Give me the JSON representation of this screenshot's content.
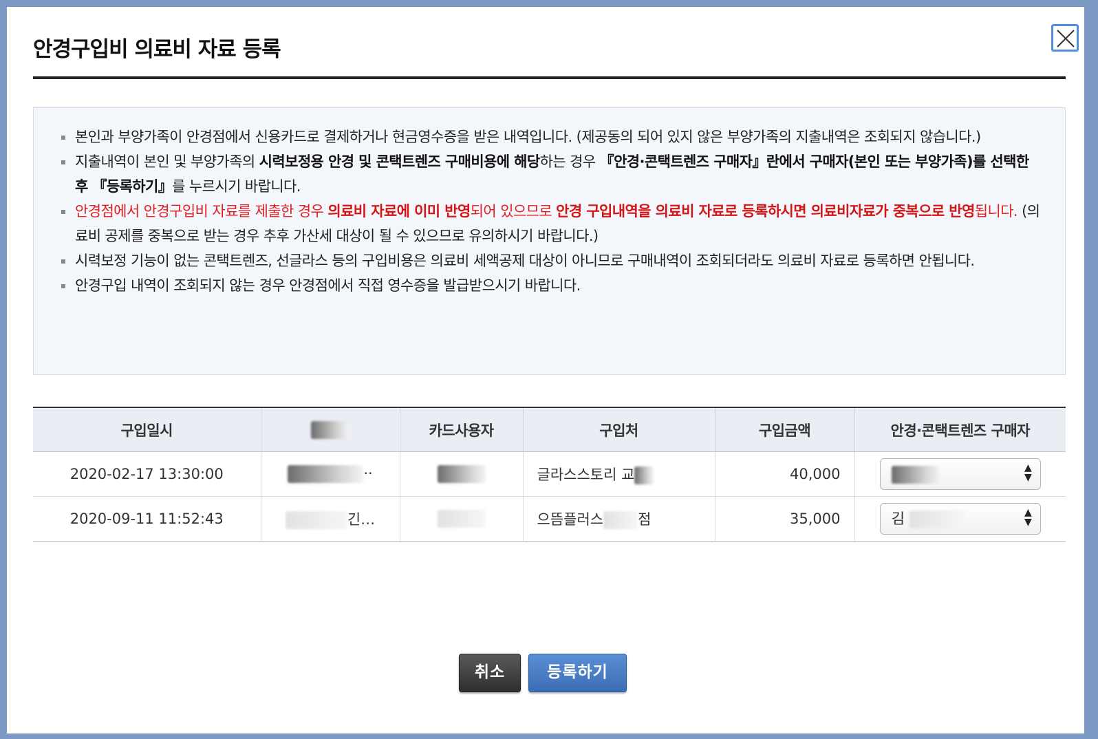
{
  "dialog": {
    "title": "안경구입비 의료비 자료 등록",
    "close_icon": "close-icon"
  },
  "notice": {
    "item1": "본인과 부양가족이 안경점에서 신용카드로 결제하거나 현금영수증을 받은 내역입니다. (제공동의 되어 있지 않은 부양가족의 지출내역은 조회되지 않습니다.)",
    "item2": {
      "t1": "지출내역이 본인 및 부양가족의 ",
      "b1": "시력보정용 안경 및 콘택트렌즈 구매비용에 해당",
      "t2": "하는 경우 ",
      "b2": "『안경·콘택트렌즈 구매자』란에서 구매자(본인 또는 부양가족)를 선택한 후 『등록하기』",
      "t3": "를 누르시기 바랍니다."
    },
    "item3": {
      "t1": "안경점에서 안경구입비 자료를 제출한 경우 ",
      "b1": "의료비 자료에 이미 반영",
      "t2": "되어 있으므로 ",
      "b2": "안경 구입내역을 의료비 자료로 등록하시면 의료비자료가 중복으로 반영",
      "t3": "됩니다.",
      "t4": " (의료비 공제를 중복으로 받는 경우 추후 가산세 대상이 될 수 있으므로 유의하시기 바랍니다.)"
    },
    "item4": "시력보정 기능이 없는 콘택트렌즈, 선글라스 등의 구입비용은 의료비 세액공제 대상이 아니므로 구매내역이 조회되더라도 의료비 자료로 등록하면 안됩니다.",
    "item5": "안경구입 내역이 조회되지 않는 경우 안경점에서 직접 영수증을 발급받으시기 바랍니다."
  },
  "table": {
    "headers": [
      "구입일시",
      "",
      "카드사용자",
      "구입처",
      "구입금액",
      "안경·콘택트렌즈 구매자"
    ],
    "rows": [
      {
        "date": "2020-02-17 13:30:00",
        "col2_suffix": "··",
        "card_user": "",
        "store": "글라스스토리 교",
        "amount": "40,000",
        "buyer": ""
      },
      {
        "date": "2020-09-11 11:52:43",
        "col2_suffix": "긴…",
        "card_user": "",
        "store": "으뜸플러스",
        "store_suffix": "점",
        "amount": "35,000",
        "buyer": "김"
      }
    ]
  },
  "buttons": {
    "cancel": "취소",
    "register": "등록하기"
  },
  "colors": {
    "accent": "#4f8ee0",
    "warning_red": "#e02020",
    "register_button": "#3a6db5",
    "cancel_button": "#333333"
  }
}
